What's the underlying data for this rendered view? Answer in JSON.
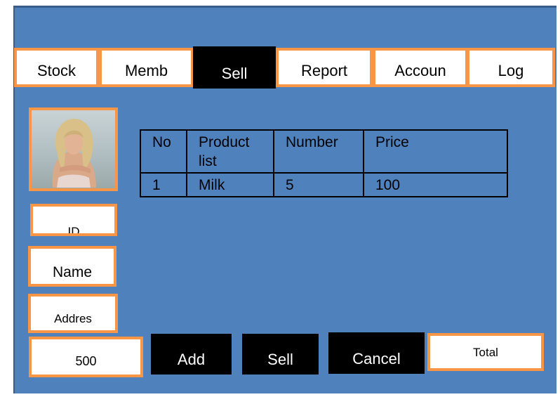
{
  "tabs": [
    {
      "label": "Stock"
    },
    {
      "label": "Memb"
    },
    {
      "label": "Sell"
    },
    {
      "label": "Report"
    },
    {
      "label": "Accoun"
    },
    {
      "label": "Log"
    }
  ],
  "member": {
    "id_label": "ID",
    "name_label": "Name",
    "address_label": "Addres",
    "amount_value": "500"
  },
  "table": {
    "headers": [
      "No",
      "Product list",
      "Number",
      "Price"
    ],
    "rows": [
      [
        "1",
        "Milk",
        "5",
        "100"
      ]
    ]
  },
  "buttons": {
    "add": "Add",
    "sell": "Sell",
    "cancel": "Cancel",
    "total": "Total"
  },
  "colors": {
    "background": "#4f81bd",
    "accent_border": "#f79646",
    "active_tab": "#000000"
  }
}
